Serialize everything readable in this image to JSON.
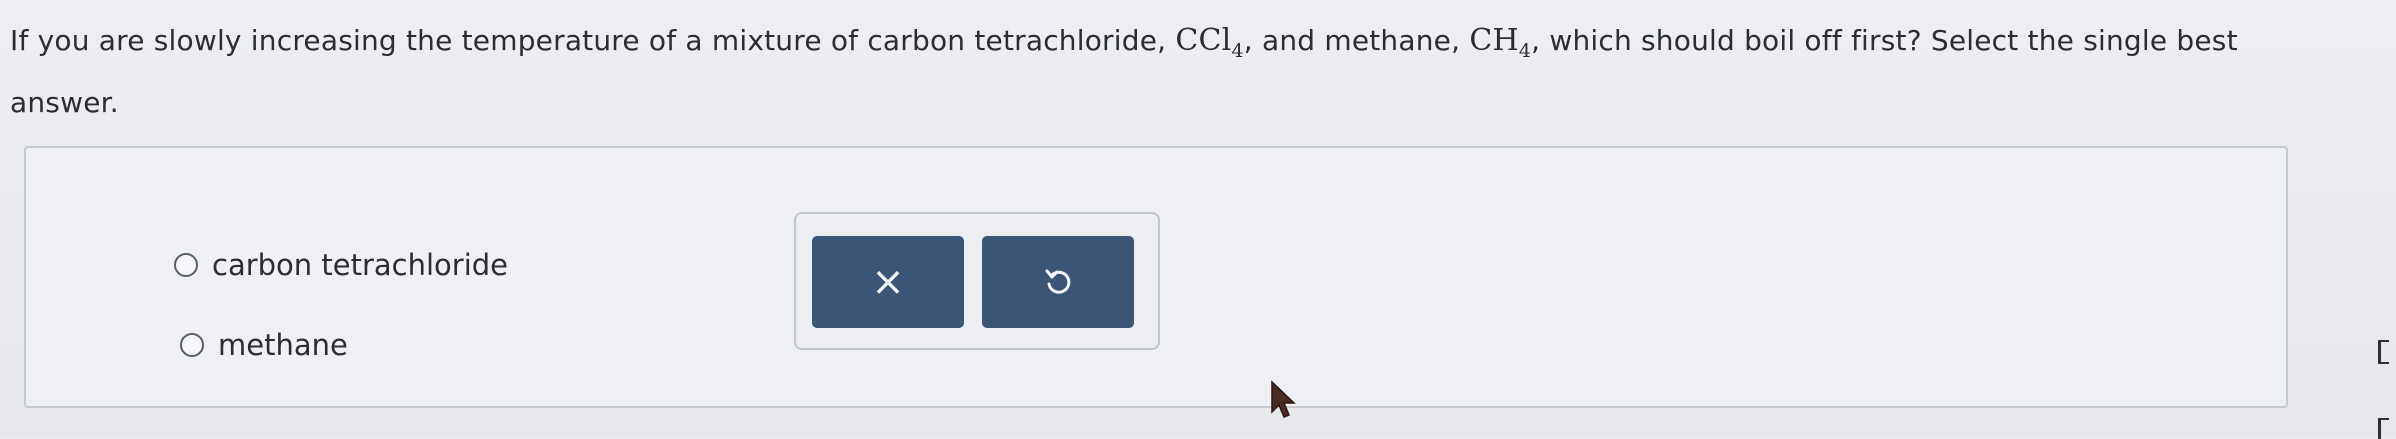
{
  "question": {
    "part1": "If you are slowly increasing the temperature of a mixture of carbon tetrachloride, ",
    "formula1_base": "CCl",
    "formula1_sub": "4",
    "part2": ", and methane, ",
    "formula2_base": "CH",
    "formula2_sub": "4",
    "part3": ", which should boil off first? Select the single best answer."
  },
  "options": [
    {
      "label": "carbon tetrachloride",
      "selected": false
    },
    {
      "label": "methane",
      "selected": false
    }
  ],
  "actions": {
    "clear_icon": "x-icon",
    "clear_glyph": "×",
    "undo_icon": "undo-icon"
  },
  "colors": {
    "button_bg": "#3b5577",
    "background": "#e9ebee",
    "text": "#2b2d31"
  }
}
